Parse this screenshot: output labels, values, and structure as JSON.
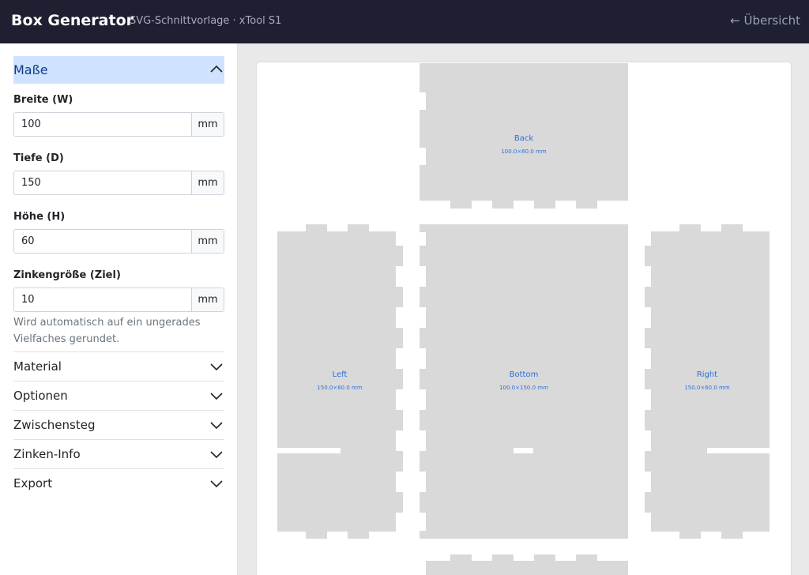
{
  "header": {
    "brand": "Box Generator",
    "subtitle": "SVG-Schnittvorlage · xTool S1",
    "overview_link": "← Übersicht"
  },
  "sidebar": {
    "open_section": "Maße",
    "fields": [
      {
        "label": "Breite (W)",
        "value": "100",
        "unit": "mm"
      },
      {
        "label": "Tiefe (D)",
        "value": "150",
        "unit": "mm"
      },
      {
        "label": "Höhe (H)",
        "value": "60",
        "unit": "mm"
      },
      {
        "label": "Zinkengröße (Ziel)",
        "value": "10",
        "unit": "mm"
      }
    ],
    "help_text": "Wird automatisch auf ein ungerades Vielfaches gerundet.",
    "sections": [
      "Material",
      "Optionen",
      "Zwischensteg",
      "Zinken-Info",
      "Export"
    ]
  },
  "preview": {
    "panels": [
      {
        "name": "Back",
        "dims": "100.0×60.0 mm"
      },
      {
        "name": "Left",
        "dims": "150.0×60.0 mm"
      },
      {
        "name": "Bottom",
        "dims": "100.0×150.0 mm"
      },
      {
        "name": "Right",
        "dims": "150.0×60.0 mm"
      }
    ]
  },
  "colors": {
    "panel_fill": "#d9d9d9",
    "label": "#2f6fd6",
    "navbar": "#1e1f30",
    "accent_bg": "#cfe2ff"
  }
}
